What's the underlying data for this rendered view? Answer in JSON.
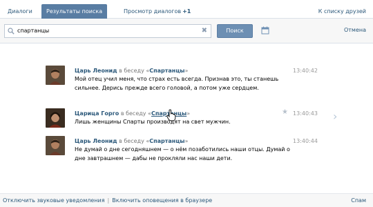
{
  "tabs": {
    "dialogs": "Диалоги",
    "search_results": "Результаты поиска",
    "view_dialogs": "Просмотр диалогов",
    "view_dialogs_count": "+1",
    "to_friends": "К списку друзей"
  },
  "search": {
    "value": "спартанцы",
    "button": "Поиск",
    "cancel": "Отмена"
  },
  "messages": [
    {
      "author": "Царь Леонид",
      "in_chat": "в беседу «",
      "chat": "Спартанцы",
      "chat_end": "»",
      "time": "13:40:42",
      "text": "Мой отец учил меня, что страх есть всегда. Признав это, ты станешь сильнее. Дерись прежде всего головой, а потом уже сердцем."
    },
    {
      "author": "Царица Горго",
      "in_chat": "в беседу «",
      "chat": "Спартанцы",
      "chat_end": "»",
      "time": "13:40:43",
      "text": "Лишь женщины Спарты производят на свет мужчин."
    },
    {
      "author": "Царь Леонид",
      "in_chat": "в беседу «",
      "chat": "Спартанцы",
      "chat_end": "»",
      "time": "13:40:44",
      "text": "Не думай о дне сегодняшнем — о нём позаботились наши отцы. Думай о дне завтрашнем — дабы не прокляли нас наши дети."
    }
  ],
  "footer": {
    "disable_sounds": "Отключить звуковые уведомления",
    "separator": "|",
    "enable_browser": "Включить оповещения в браузере",
    "spam": "Спам"
  },
  "colors": {
    "accent": "#597da3",
    "link": "#2b587a"
  }
}
